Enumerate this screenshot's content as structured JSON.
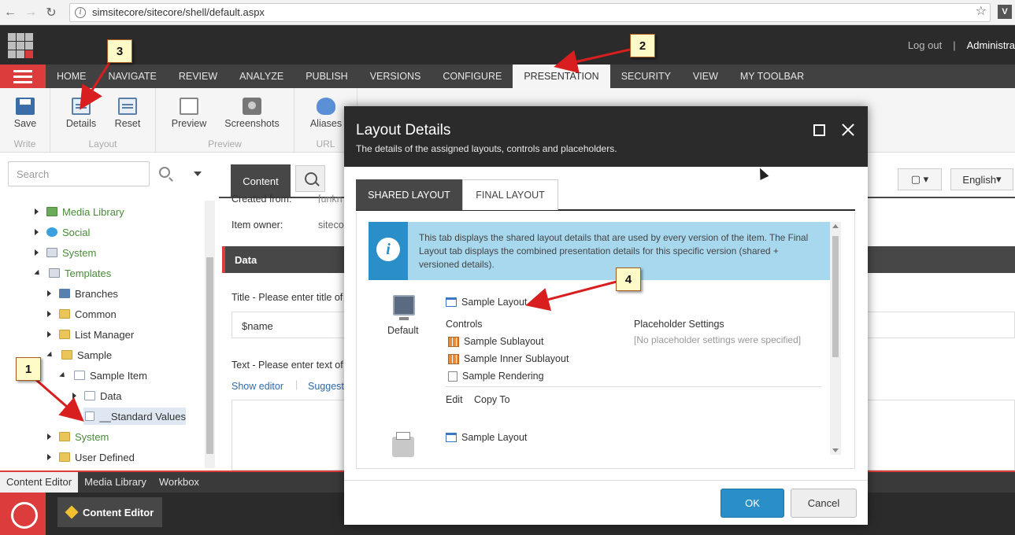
{
  "browser": {
    "url": "simsitecore/sitecore/shell/default.aspx",
    "back_icon": "back-arrow-icon",
    "forward_icon": "forward-arrow-icon",
    "reload_icon": "reload-icon"
  },
  "header": {
    "logout": "Log out",
    "separator": "|",
    "user": "Administra"
  },
  "ribbon": {
    "tabs": [
      "HOME",
      "NAVIGATE",
      "REVIEW",
      "ANALYZE",
      "PUBLISH",
      "VERSIONS",
      "CONFIGURE",
      "PRESENTATION",
      "SECURITY",
      "VIEW",
      "MY TOOLBAR"
    ],
    "active_tab": "PRESENTATION",
    "groups": {
      "write": {
        "title": "Write",
        "save": "Save"
      },
      "layout": {
        "title": "Layout",
        "details": "Details",
        "reset": "Reset"
      },
      "preview": {
        "title": "Preview",
        "preview": "Preview",
        "screenshots": "Screenshots"
      },
      "url": {
        "title": "URL",
        "aliases": "Aliases"
      }
    }
  },
  "search": {
    "placeholder": "Search"
  },
  "tree": {
    "items": [
      {
        "label": "Media Library",
        "state": "collapsed",
        "icon": "image-icon"
      },
      {
        "label": "Social",
        "state": "collapsed",
        "icon": "globe-icon"
      },
      {
        "label": "System",
        "state": "collapsed",
        "icon": "system-icon"
      },
      {
        "label": "Templates",
        "state": "expanded",
        "icon": "template-icon"
      },
      {
        "label": "Branches",
        "state": "collapsed",
        "icon": "branch-icon"
      },
      {
        "label": "Common",
        "state": "collapsed",
        "icon": "folder-icon"
      },
      {
        "label": "List Manager",
        "state": "collapsed",
        "icon": "folder-icon"
      },
      {
        "label": "Sample",
        "state": "expanded",
        "icon": "folder-icon"
      },
      {
        "label": "Sample Item",
        "state": "expanded",
        "icon": "page-icon"
      },
      {
        "label": "Data",
        "state": "collapsed",
        "icon": "page-icon"
      },
      {
        "label": "__Standard Values",
        "state": "leaf",
        "icon": "page-icon"
      },
      {
        "label": "System",
        "state": "collapsed",
        "icon": "folder-icon"
      },
      {
        "label": "User Defined",
        "state": "collapsed",
        "icon": "folder-icon"
      }
    ]
  },
  "content": {
    "tab": "Content",
    "created_from_label": "Created from:",
    "created_from_value": "[unkn",
    "item_owner_label": "Item owner:",
    "item_owner_value": "siteco",
    "data_section": "Data",
    "title_label": "Title - Please enter title of",
    "title_value": "$name",
    "text_label": "Text - Please enter text of",
    "show_editor": "Show editor",
    "suggest": "Suggest",
    "language": "English"
  },
  "bottom_tabs": [
    "Content Editor",
    "Media Library",
    "Workbox"
  ],
  "taskbar": {
    "item": "Content Editor"
  },
  "modal": {
    "title": "Layout Details",
    "subtitle": "The details of the assigned layouts, controls and placeholders.",
    "tabs": {
      "shared": "SHARED LAYOUT",
      "final": "FINAL LAYOUT"
    },
    "info": "This tab displays the shared layout details that are used by every version of the item. The Final Layout tab displays the combined presentation details for this specific version (shared + versioned details).",
    "devices": [
      {
        "name": "Default",
        "layout": "Sample Layout",
        "controls_label": "Controls",
        "controls": [
          "Sample Sublayout",
          "Sample Inner Sublayout",
          "Sample Rendering"
        ],
        "placeholder_label": "Placeholder Settings",
        "placeholder_value": "[No placeholder settings were specified]",
        "edit": "Edit",
        "copy_to": "Copy To"
      },
      {
        "name": "",
        "layout": "Sample Layout"
      }
    ],
    "ok": "OK",
    "cancel": "Cancel"
  },
  "callouts": [
    "1",
    "2",
    "3",
    "4"
  ],
  "colors": {
    "accent": "#dd3c3c",
    "primary": "#2a8fc9",
    "dark": "#2b2b2b"
  }
}
